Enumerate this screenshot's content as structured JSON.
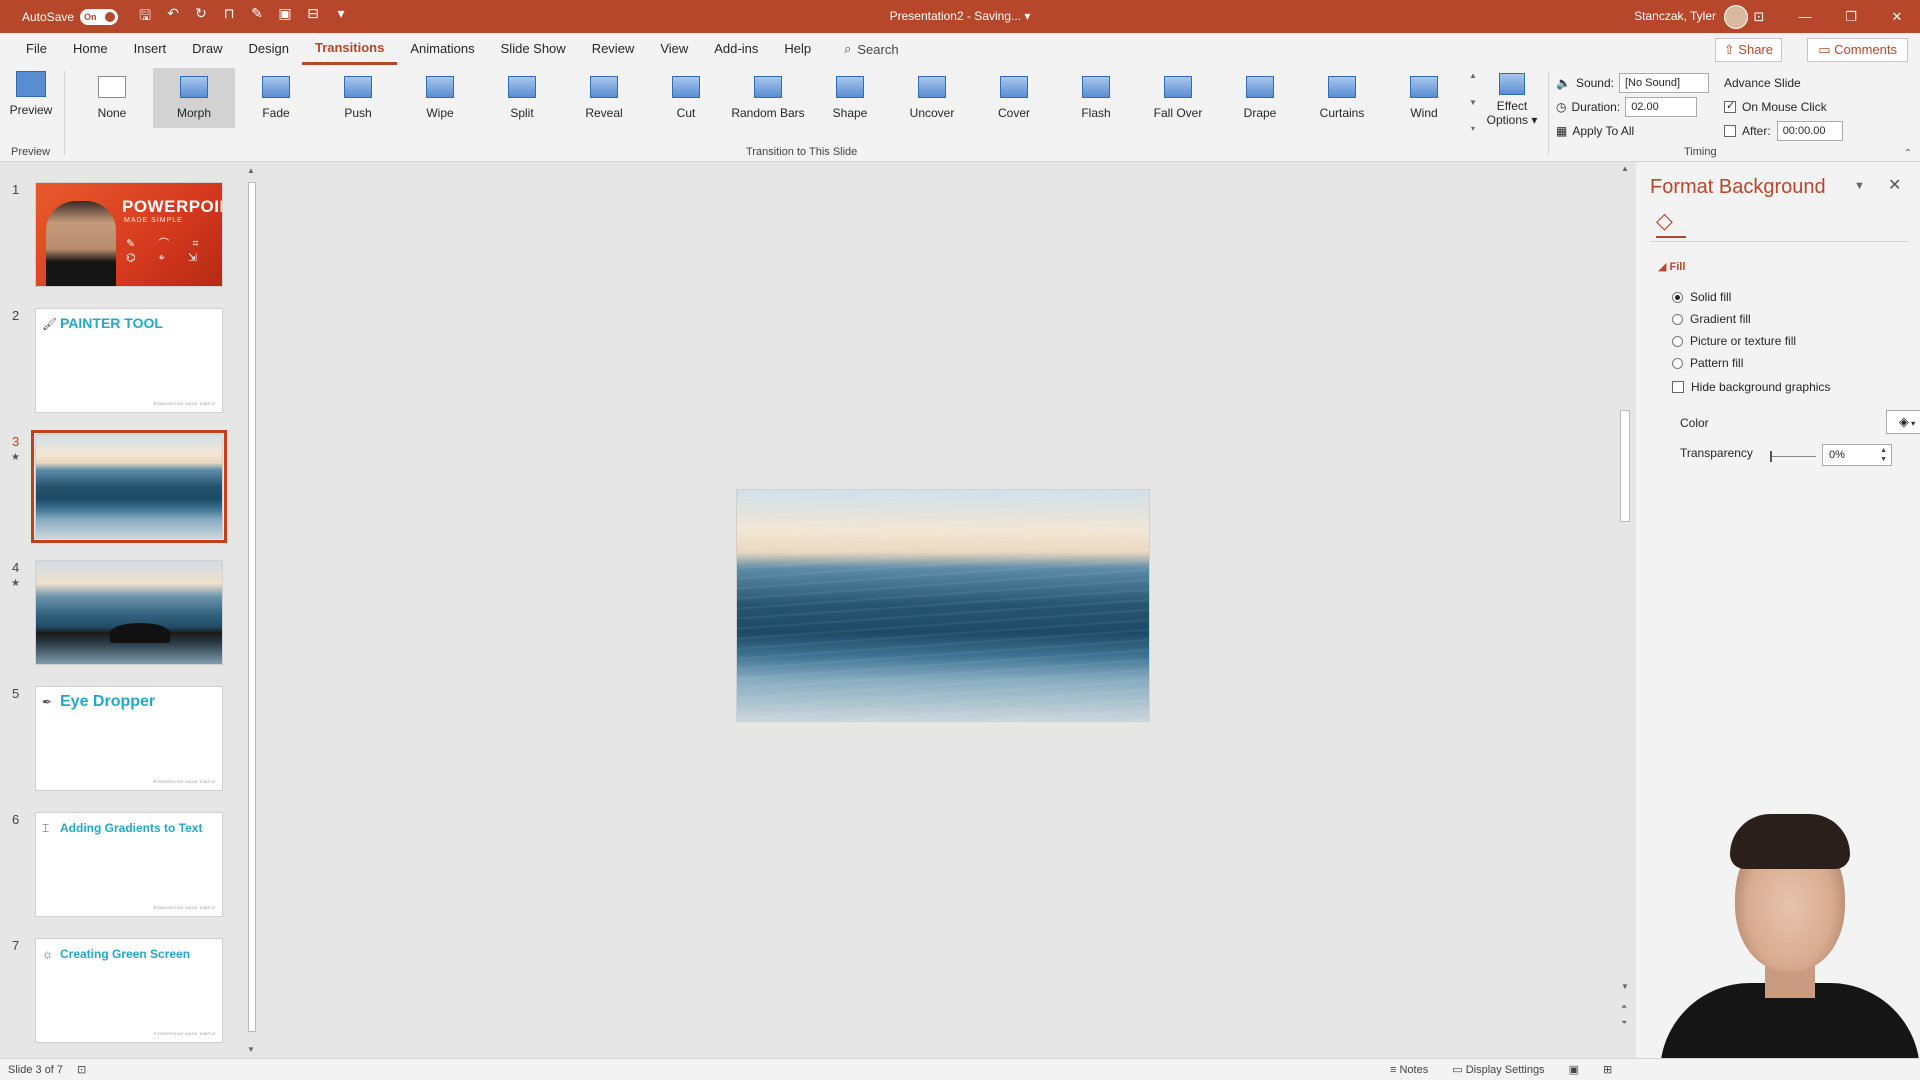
{
  "titlebar": {
    "autosave_label": "AutoSave",
    "autosave_state": "On",
    "document_title": "Presentation2 - Saving...",
    "user_name": "Stanczak, Tyler"
  },
  "tabs": [
    "File",
    "Home",
    "Insert",
    "Draw",
    "Design",
    "Transitions",
    "Animations",
    "Slide Show",
    "Review",
    "View",
    "Add-ins",
    "Help"
  ],
  "active_tab": "Transitions",
  "search_label": "Search",
  "share_label": "Share",
  "comments_label": "Comments",
  "ribbon": {
    "preview_label": "Preview",
    "preview_group": "Preview",
    "transitions": [
      "None",
      "Morph",
      "Fade",
      "Push",
      "Wipe",
      "Split",
      "Reveal",
      "Cut",
      "Random Bars",
      "Shape",
      "Uncover",
      "Cover",
      "Flash",
      "Fall Over",
      "Drape",
      "Curtains",
      "Wind"
    ],
    "selected_transition": "Morph",
    "effect_options_label_1": "Effect",
    "effect_options_label_2": "Options",
    "transition_group": "Transition to This Slide",
    "sound_label": "Sound:",
    "sound_value": "[No Sound]",
    "duration_label": "Duration:",
    "duration_value": "02.00",
    "apply_all_label": "Apply To All",
    "advance_slide_label": "Advance Slide",
    "on_mouse_click_label": "On Mouse Click",
    "after_label": "After:",
    "after_value": "00:00.00",
    "timing_group": "Timing"
  },
  "slides": [
    {
      "num": "1",
      "title_1": "POWERPOINT",
      "title_2": "MADE SIMPLE",
      "kind": "cover"
    },
    {
      "num": "2",
      "title": "PAINTER TOOL",
      "kind": "text",
      "footer": "POWERPOINT MADE SIMPLE"
    },
    {
      "num": "3",
      "kind": "ocean",
      "star": "★"
    },
    {
      "num": "4",
      "kind": "ocean2",
      "star": "★"
    },
    {
      "num": "5",
      "title": "Eye Dropper",
      "kind": "text",
      "footer": "POWERPOINT MADE SIMPLE"
    },
    {
      "num": "6",
      "title": "Adding Gradients to Text",
      "kind": "text",
      "footer": "POWERPOINT MADE SIMPLE"
    },
    {
      "num": "7",
      "title": "Creating Green Screen",
      "kind": "text",
      "footer": "POWERPOINT MADE SIMPLE"
    }
  ],
  "selected_slide": "3",
  "format_background": {
    "title": "Format Background",
    "fill_heading": "Fill",
    "options": [
      "Solid fill",
      "Gradient fill",
      "Picture or texture fill",
      "Pattern fill"
    ],
    "selected_option": "Solid fill",
    "hide_graphics_label": "Hide background graphics",
    "color_label": "Color",
    "transparency_label": "Transparency",
    "transparency_value": "0%"
  },
  "statusbar": {
    "slide_info": "Slide 3 of 7",
    "notes_label": "Notes",
    "display_settings_label": "Display Settings"
  },
  "colors": {
    "accent": "#b7472a",
    "selection": "#c43e1c",
    "thumb_title": "#22a9c9"
  }
}
